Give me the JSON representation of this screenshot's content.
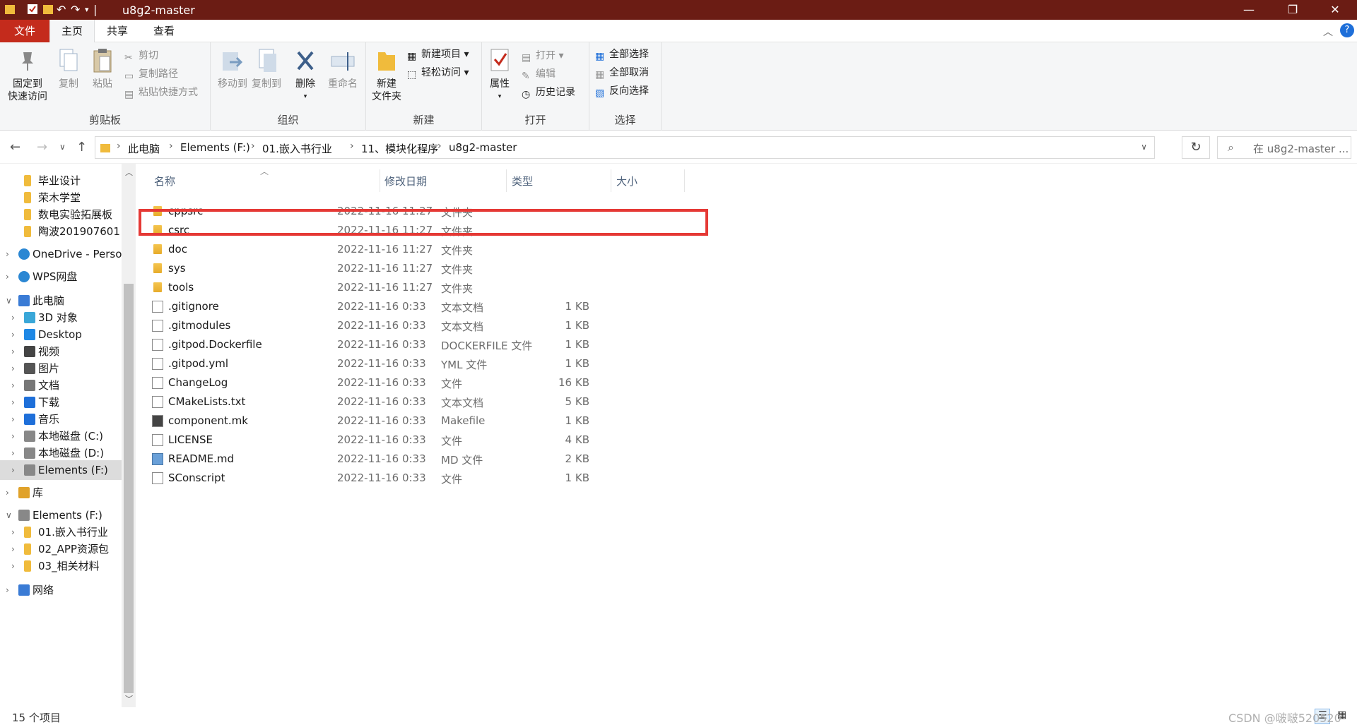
{
  "window": {
    "title": "u8g2-master",
    "controls": {
      "minimize": "—",
      "restore": "❐",
      "close": "✕"
    }
  },
  "ribbon_tabs": [
    {
      "label": "文件"
    },
    {
      "label": "主页"
    },
    {
      "label": "共享"
    },
    {
      "label": "查看"
    }
  ],
  "ribbon": {
    "clipboard": {
      "label": "剪贴板",
      "pin": "固定到\n快速访问",
      "pin_line1": "固定到",
      "pin_line2": "快速访问",
      "copy": "复制",
      "paste": "粘贴",
      "cut": "剪切",
      "copy_path": "复制路径",
      "paste_shortcut": "粘贴快捷方式"
    },
    "organize": {
      "label": "组织",
      "move_to": "移动到",
      "copy_to": "复制到",
      "delete": "删除",
      "rename": "重命名"
    },
    "new": {
      "label": "新建",
      "new_folder_line1": "新建",
      "new_folder_line2": "文件夹",
      "new_item": "新建项目",
      "easy_access": "轻松访问"
    },
    "open": {
      "label": "打开",
      "properties": "属性",
      "open": "打开",
      "edit": "编辑",
      "history": "历史记录"
    },
    "select": {
      "label": "选择",
      "select_all": "全部选择",
      "select_none": "全部取消",
      "invert": "反向选择"
    }
  },
  "address": {
    "crumbs": [
      "此电脑",
      "Elements (F:)",
      "01.嵌入书行业",
      "11、模块化程序",
      "u8g2-master"
    ],
    "search_placeholder": "在 u8g2-master ..."
  },
  "nav": [
    {
      "label": "毕业设计",
      "icon": "folder-icon",
      "level": 2,
      "chevron": ""
    },
    {
      "label": "荣木学堂",
      "icon": "folder-icon",
      "level": 2,
      "chevron": ""
    },
    {
      "label": "数电实验拓展板",
      "icon": "folder-icon",
      "level": 2,
      "chevron": ""
    },
    {
      "label": "陶波201907601",
      "icon": "folder-icon",
      "level": 2,
      "chevron": ""
    },
    {
      "label": "OneDrive - Perso",
      "icon": "cloud-icon",
      "level": 1,
      "chevron": ">"
    },
    {
      "label": "WPS网盘",
      "icon": "cloud-icon",
      "level": 1,
      "chevron": ">"
    },
    {
      "label": "此电脑",
      "icon": "computer-icon",
      "level": 1,
      "chevron": "v"
    },
    {
      "label": "3D 对象",
      "icon": "cube-icon",
      "level": 2,
      "chevron": ">"
    },
    {
      "label": "Desktop",
      "icon": "desktop-icon",
      "level": 2,
      "chevron": ">"
    },
    {
      "label": "视频",
      "icon": "video-icon",
      "level": 2,
      "chevron": ">"
    },
    {
      "label": "图片",
      "icon": "picture-icon",
      "level": 2,
      "chevron": ">"
    },
    {
      "label": "文档",
      "icon": "document-icon",
      "level": 2,
      "chevron": ">"
    },
    {
      "label": "下载",
      "icon": "download-icon",
      "level": 2,
      "chevron": ">"
    },
    {
      "label": "音乐",
      "icon": "music-icon",
      "level": 2,
      "chevron": ">"
    },
    {
      "label": "本地磁盘 (C:)",
      "icon": "drive-icon",
      "level": 2,
      "chevron": ">"
    },
    {
      "label": "本地磁盘 (D:)",
      "icon": "drive-icon",
      "level": 2,
      "chevron": ">"
    },
    {
      "label": "Elements (F:)",
      "icon": "drive-icon",
      "level": 2,
      "chevron": ">",
      "selected": true
    },
    {
      "label": "库",
      "icon": "library-icon",
      "level": 1,
      "chevron": ">"
    },
    {
      "label": "Elements (F:)",
      "icon": "drive-icon",
      "level": 1,
      "chevron": "v"
    },
    {
      "label": "01.嵌入书行业",
      "icon": "folder-icon",
      "level": 2,
      "chevron": ">"
    },
    {
      "label": "02_APP资源包",
      "icon": "folder-icon",
      "level": 2,
      "chevron": ">"
    },
    {
      "label": "03_相关材料",
      "icon": "folder-icon",
      "level": 2,
      "chevron": ">"
    },
    {
      "label": "网络",
      "icon": "network-icon",
      "level": 1,
      "chevron": ">"
    }
  ],
  "columns": {
    "name": "名称",
    "date": "修改日期",
    "type": "类型",
    "size": "大小"
  },
  "files": [
    {
      "name": "cppsrc",
      "date": "2022-11-16 11:27",
      "type": "文件夹",
      "size": "",
      "kind": "folder"
    },
    {
      "name": "csrc",
      "date": "2022-11-16 11:27",
      "type": "文件夹",
      "size": "",
      "kind": "folder"
    },
    {
      "name": "doc",
      "date": "2022-11-16 11:27",
      "type": "文件夹",
      "size": "",
      "kind": "folder"
    },
    {
      "name": "sys",
      "date": "2022-11-16 11:27",
      "type": "文件夹",
      "size": "",
      "kind": "folder"
    },
    {
      "name": "tools",
      "date": "2022-11-16 11:27",
      "type": "文件夹",
      "size": "",
      "kind": "folder"
    },
    {
      "name": ".gitignore",
      "date": "2022-11-16 0:33",
      "type": "文本文档",
      "size": "1 KB",
      "kind": "text"
    },
    {
      "name": ".gitmodules",
      "date": "2022-11-16 0:33",
      "type": "文本文档",
      "size": "1 KB",
      "kind": "text"
    },
    {
      "name": ".gitpod.Dockerfile",
      "date": "2022-11-16 0:33",
      "type": "DOCKERFILE 文件",
      "size": "1 KB",
      "kind": "file"
    },
    {
      "name": ".gitpod.yml",
      "date": "2022-11-16 0:33",
      "type": "YML 文件",
      "size": "1 KB",
      "kind": "file"
    },
    {
      "name": "ChangeLog",
      "date": "2022-11-16 0:33",
      "type": "文件",
      "size": "16 KB",
      "kind": "file"
    },
    {
      "name": "CMakeLists.txt",
      "date": "2022-11-16 0:33",
      "type": "文本文档",
      "size": "5 KB",
      "kind": "text"
    },
    {
      "name": "component.mk",
      "date": "2022-11-16 0:33",
      "type": "Makefile",
      "size": "1 KB",
      "kind": "make"
    },
    {
      "name": "LICENSE",
      "date": "2022-11-16 0:33",
      "type": "文件",
      "size": "4 KB",
      "kind": "file"
    },
    {
      "name": "README.md",
      "date": "2022-11-16 0:33",
      "type": "MD 文件",
      "size": "2 KB",
      "kind": "md"
    },
    {
      "name": "SConscript",
      "date": "2022-11-16 0:33",
      "type": "文件",
      "size": "1 KB",
      "kind": "file"
    }
  ],
  "status": {
    "count": "15 个项目"
  },
  "watermark": "CSDN @啵啵520520",
  "colors": {
    "titlebar": "#6b1c14",
    "file_tab": "#c42b1c",
    "highlight_border": "#e53935",
    "folder": "#f0bb3c"
  }
}
